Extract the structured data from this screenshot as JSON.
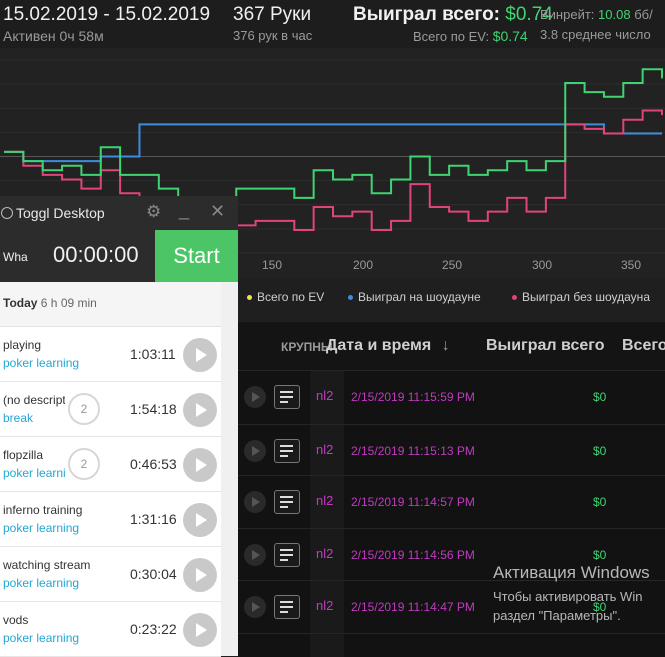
{
  "header": {
    "date_range": "15.02.2019 - 15.02.2019",
    "active": "Активен 0ч 58м",
    "hands": "367 Руки",
    "hands_rate": "376 рук в час",
    "won_label": "Выиграл всего:",
    "won_value": "$0.74",
    "ev_label": "Всего по EV:",
    "ev_value": "$0.74",
    "winrate_label": "Винрейт:",
    "winrate_value": "10.08",
    "winrate_unit": "бб/",
    "avg": "3.8 среднее число"
  },
  "chart_data": {
    "type": "line",
    "x_ticks": [
      "150",
      "200",
      "250",
      "300",
      "350"
    ],
    "series": [
      {
        "name": "Всего по EV",
        "color": "#f2e34a",
        "values": []
      },
      {
        "name": "Выиграл на шоудауне",
        "color": "#3c8de0",
        "values": [
          0,
          -0.2,
          -0.2,
          -0.2,
          -0.2,
          -0.1,
          -0.1,
          0.6,
          0.6,
          0.6,
          0.6,
          0.6,
          0.6,
          0.6,
          0.6,
          0.6,
          0.6,
          0.6,
          0.6,
          0.6,
          0.6,
          0.6,
          0.6,
          0.6,
          0.6,
          0.6,
          0.6,
          0.6,
          0.6,
          0.6,
          0.6,
          0.4,
          0.4,
          0.4,
          0.4
        ]
      },
      {
        "name": "Выиграл без шоудауна",
        "color": "#e0447a",
        "values": [
          0,
          -0.3,
          -0.5,
          -0.6,
          -0.8,
          -0.4,
          -0.9,
          -1.0,
          -1.3,
          -2.1,
          -2.0,
          -1.6,
          -1.6,
          -1.5,
          -1.5,
          -1.7,
          -1.2,
          -1.4,
          -1.3,
          -1.7,
          -1.5,
          -0.7,
          -1.2,
          -1.3,
          -1.5,
          -1.3,
          -1.0,
          -1.3,
          -1.0,
          0.6,
          0.5,
          0.4,
          0.7,
          0.9,
          0.8
        ]
      },
      {
        "name": "Выиграл всего",
        "color": "#3fd472",
        "values": [
          0,
          -0.2,
          -0.4,
          -0.3,
          -0.5,
          0.1,
          -0.5,
          -0.5,
          -0.8,
          -1.4,
          -1.3,
          -1.0,
          -0.8,
          -0.8,
          -0.8,
          -1.0,
          -0.4,
          -0.6,
          -0.5,
          -0.9,
          -0.6,
          -0.1,
          -0.5,
          -0.3,
          -0.5,
          -0.4,
          -0.2,
          -0.4,
          -0.2,
          1.5,
          1.3,
          1.2,
          1.5,
          1.8,
          1.6
        ]
      }
    ],
    "legend": [
      "Всего по EV",
      "Выиграл на шоудауне",
      "Выиграл без шоудауна"
    ],
    "grid": true
  },
  "table": {
    "col_big": "КРУПНЫ",
    "col_datetime": "Дата и время",
    "sort_arrow": "↓",
    "col_won": "Выиграл всего",
    "col_total": "Всего",
    "rows": [
      {
        "limit": "nl2",
        "datetime": "2/15/2019 11:15:59 PM",
        "amount": "$0"
      },
      {
        "limit": "nl2",
        "datetime": "2/15/2019 11:15:13 PM",
        "amount": "$0"
      },
      {
        "limit": "nl2",
        "datetime": "2/15/2019 11:14:57 PM",
        "amount": "$0"
      },
      {
        "limit": "nl2",
        "datetime": "2/15/2019 11:14:56 PM",
        "amount": "$0"
      },
      {
        "limit": "nl2",
        "datetime": "2/15/2019 11:14:47 PM",
        "amount": "$0"
      }
    ]
  },
  "watermark": {
    "line1": "Активация Windows",
    "line2": "Чтобы активировать Win",
    "line3": "раздел \"Параметры\"."
  },
  "toggl": {
    "title": "Toggl Desktop",
    "desc_placeholder": "Wha",
    "timer": "00:00:00",
    "start_label": "Start",
    "today_label": "Today",
    "today_total": "6 h 09 min",
    "entries": [
      {
        "description": "playing",
        "project": "poker learning",
        "count": "",
        "duration": "1:03:11"
      },
      {
        "description": "(no description)",
        "project": "break",
        "count": "2",
        "duration": "1:54:18"
      },
      {
        "description": "flopzilla",
        "project": "poker learning",
        "count": "2",
        "duration": "0:46:53"
      },
      {
        "description": "inferno training",
        "project": "poker learning",
        "count": "",
        "duration": "1:31:16"
      },
      {
        "description": "watching stream",
        "project": "poker learning",
        "count": "",
        "duration": "0:30:04"
      },
      {
        "description": "vods",
        "project": "poker learning",
        "count": "",
        "duration": "0:23:22"
      }
    ]
  }
}
